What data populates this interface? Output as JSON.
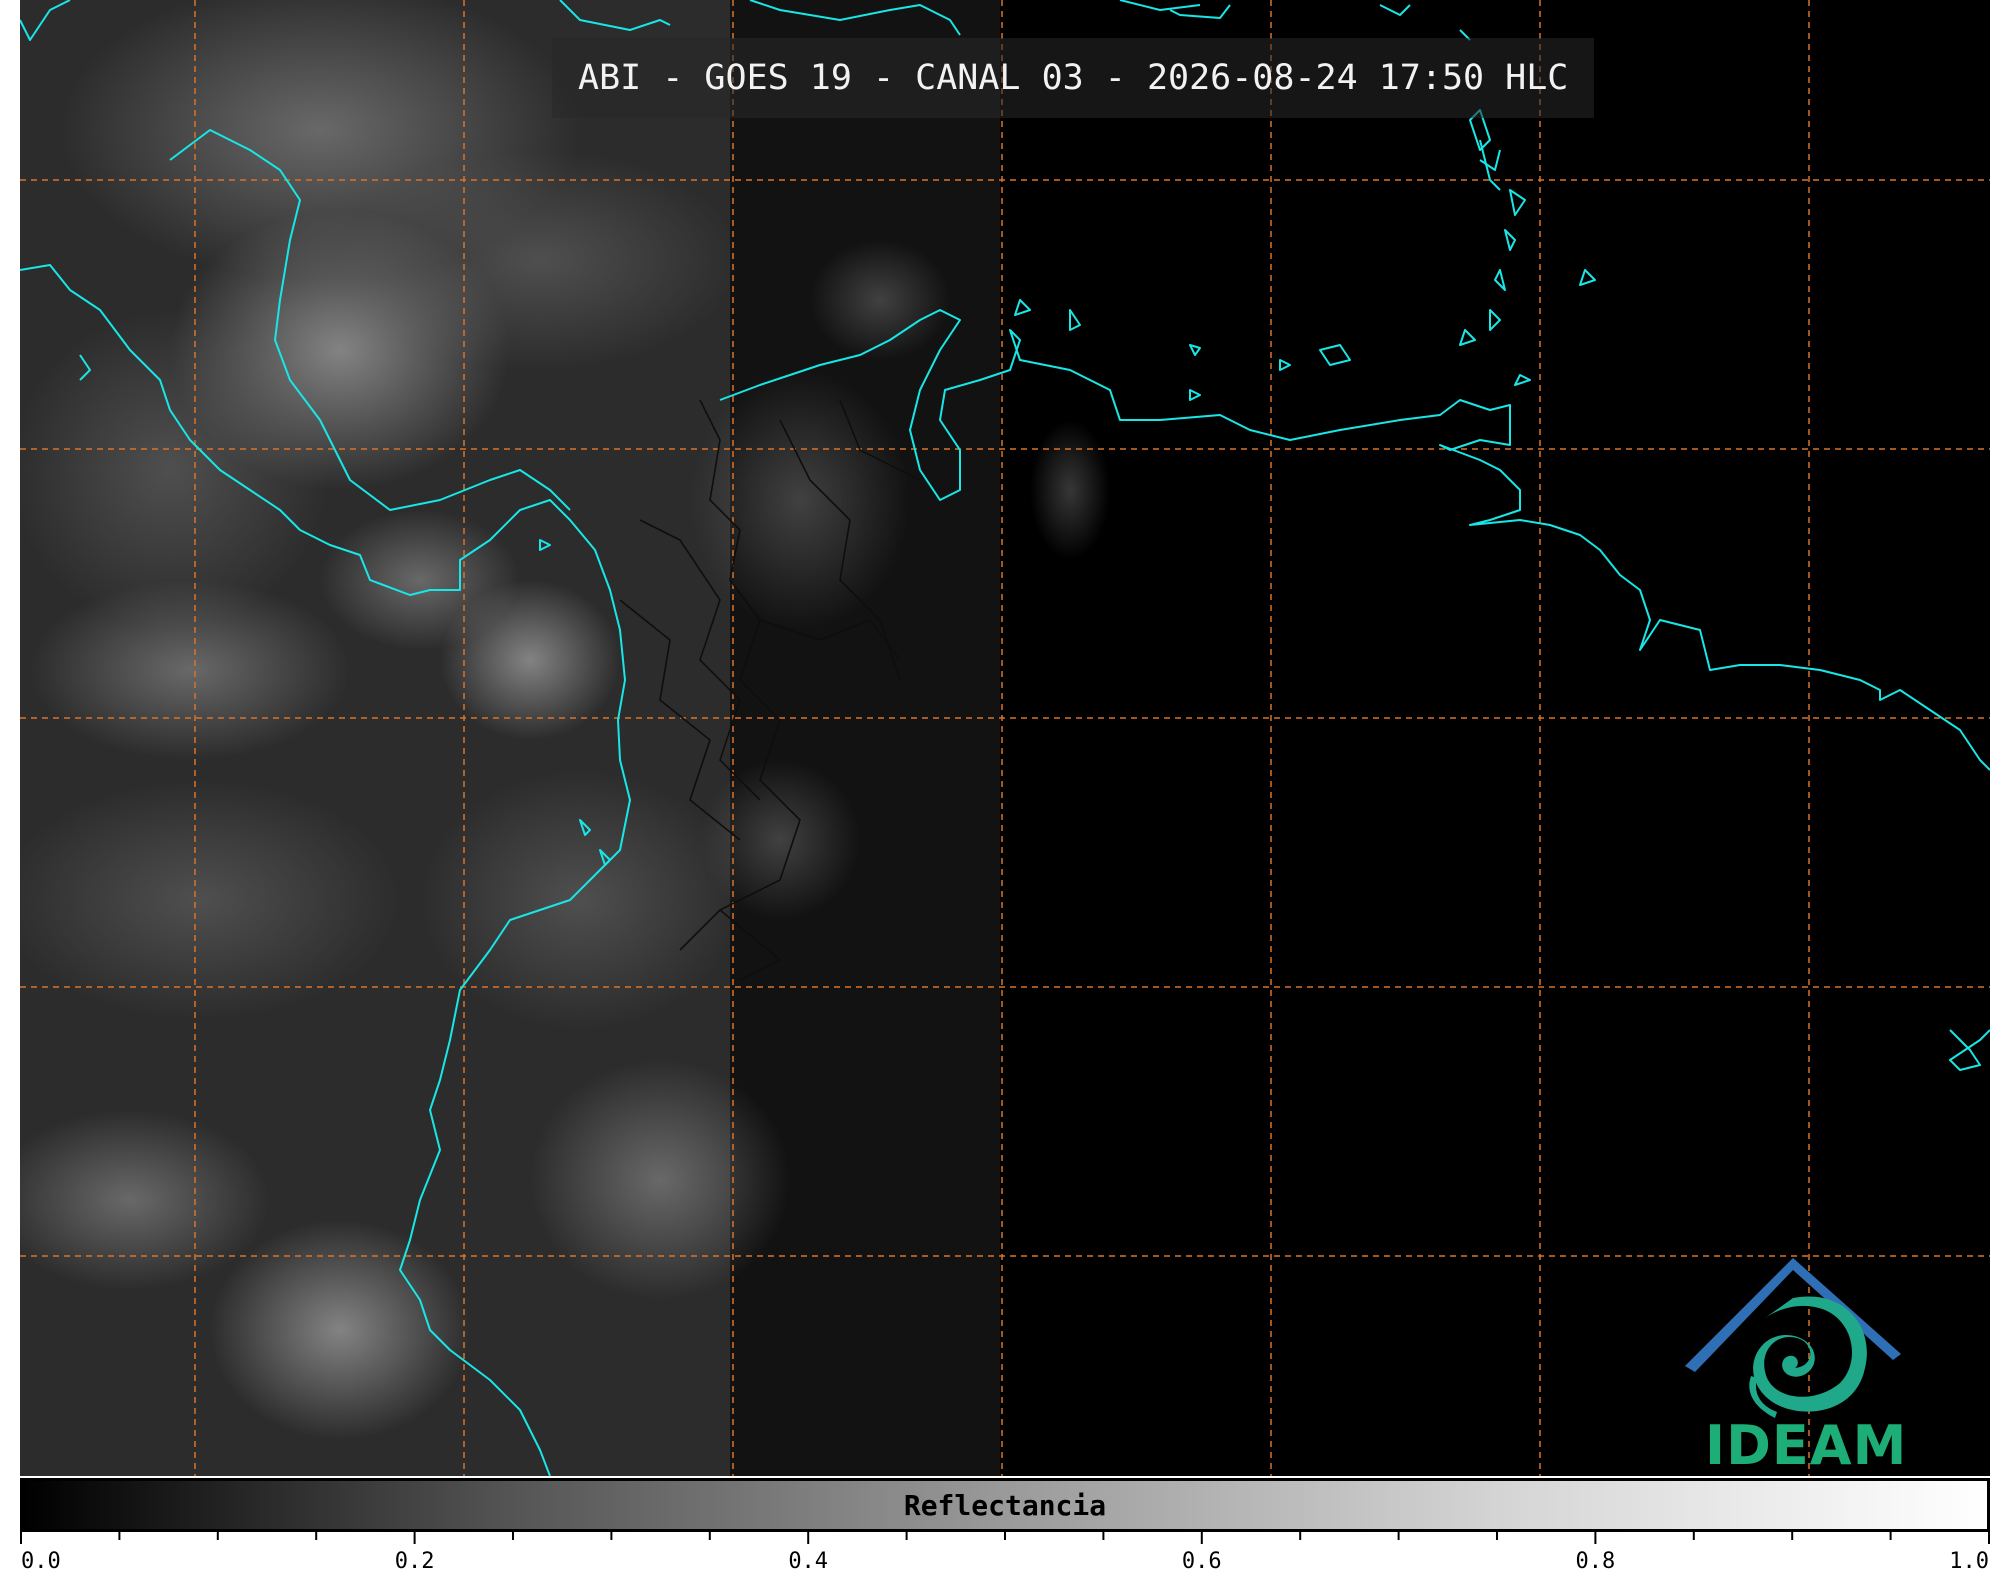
{
  "title": "ABI - GOES 19 - CANAL 03 - 2026-08-24 17:50 HLC",
  "colorbar": {
    "label": "Reflectancia",
    "range": [
      0.0,
      1.0
    ],
    "tick_labels": [
      "0.0",
      "0.2",
      "0.4",
      "0.6",
      "0.8",
      "1.0"
    ],
    "gradient": "grayscale black-to-white"
  },
  "logo": {
    "text": "IDEAM",
    "colors": {
      "roof": "#2f6fb5",
      "swirl": "#1fa98a",
      "text": "#1dae77"
    }
  },
  "map": {
    "grid_color": "#d9742a",
    "coastline_color": "#19e6e6",
    "border_color": "#111111",
    "background_color": "#000000"
  }
}
